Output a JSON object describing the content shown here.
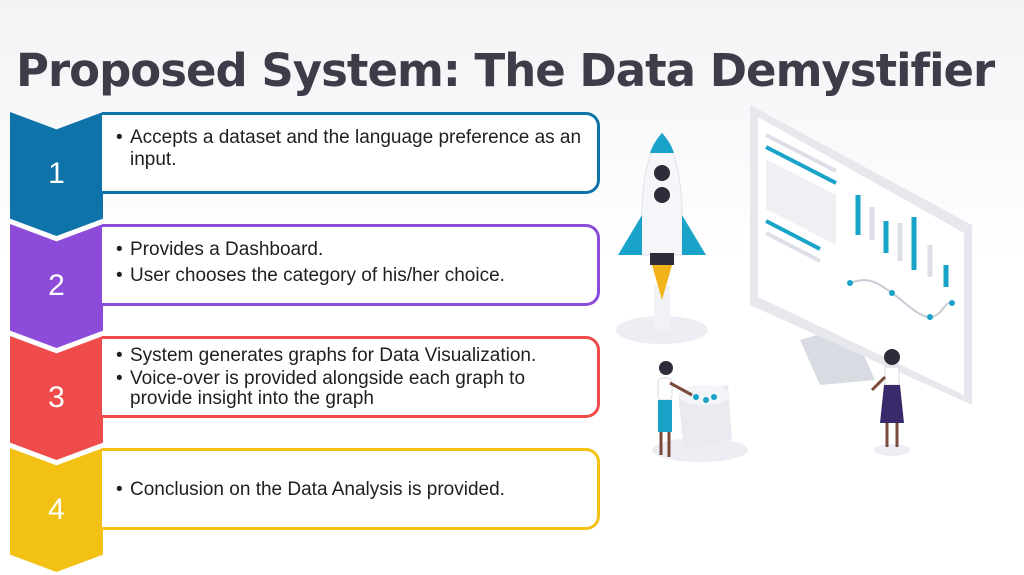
{
  "title": "Proposed System: The Data Demystifier",
  "steps": [
    {
      "number": "1",
      "color": "#0e73a8",
      "bullets": [
        "Accepts a dataset and the language preference as an input."
      ]
    },
    {
      "number": "2",
      "color": "#8d4bd9",
      "bullets": [
        "Provides a Dashboard.",
        "User chooses the category of his/her choice."
      ]
    },
    {
      "number": "3",
      "color": "#ef4b4b",
      "bullets": [
        "System generates graphs for Data Visualization.",
        "Voice-over is provided alongside each graph to provide insight into the graph"
      ]
    },
    {
      "number": "4",
      "color": "#f2c114",
      "bullets": [
        "Conclusion on the Data Analysis is provided."
      ]
    }
  ],
  "illustration": {
    "accent": "#1aa3c9",
    "icons": [
      "rocket-icon",
      "monitor-dashboard-icon",
      "person-pressing-button-icon",
      "person-presenting-icon"
    ]
  }
}
